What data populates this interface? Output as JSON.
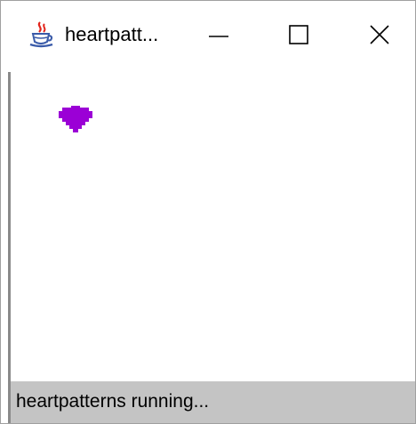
{
  "window": {
    "title": "heartpatt...",
    "controls": {
      "minimize_icon": "minimize-icon",
      "maximize_icon": "maximize-icon",
      "close_icon": "close-icon"
    }
  },
  "canvas": {
    "sprite": "heart-icon",
    "sprite_color": "#9b00d6"
  },
  "statusbar": {
    "text": "heartpatterns running..."
  },
  "colors": {
    "titlebar_bg": "#ffffff",
    "statusbar_bg": "#c4c4c4",
    "client_bg": "#ffffff"
  }
}
